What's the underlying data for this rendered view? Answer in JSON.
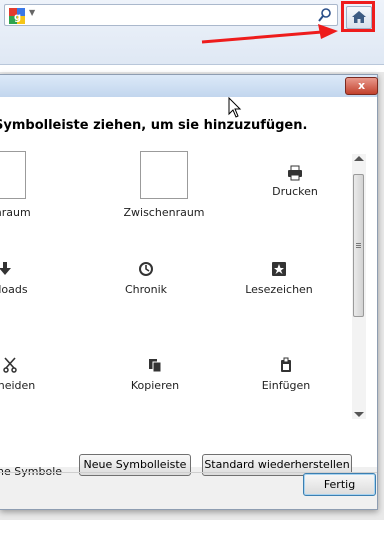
{
  "browser": {
    "search_engine_icon": "google-icon",
    "search_go_icon": "magnifier-icon",
    "home_icon": "home-icon",
    "highlight_color": "#ee1c1c"
  },
  "dialog": {
    "instruction": "Symbolleiste ziehen, um sie hinzuzufügen.",
    "close_label": "x",
    "items": [
      {
        "label": "schenraum",
        "icon": "separator-icon"
      },
      {
        "label": "Zwischenraum",
        "icon": "spacer-icon"
      },
      {
        "label": "Drucken",
        "icon": "printer-icon"
      },
      {
        "label": "wnloads",
        "icon": "download-icon"
      },
      {
        "label": "Chronik",
        "icon": "history-icon"
      },
      {
        "label": "Lesezeichen",
        "icon": "bookmarks-icon"
      },
      {
        "label": "chneiden",
        "icon": "scissors-icon"
      },
      {
        "label": "Kopieren",
        "icon": "copy-icon"
      },
      {
        "label": "Einfügen",
        "icon": "paste-icon"
      }
    ],
    "small_icons_label": "ine Symbole",
    "new_toolbar_button": "Neue Symbolleiste",
    "restore_default_button": "Standard wiederherstellen",
    "done_button": "Fertig"
  }
}
